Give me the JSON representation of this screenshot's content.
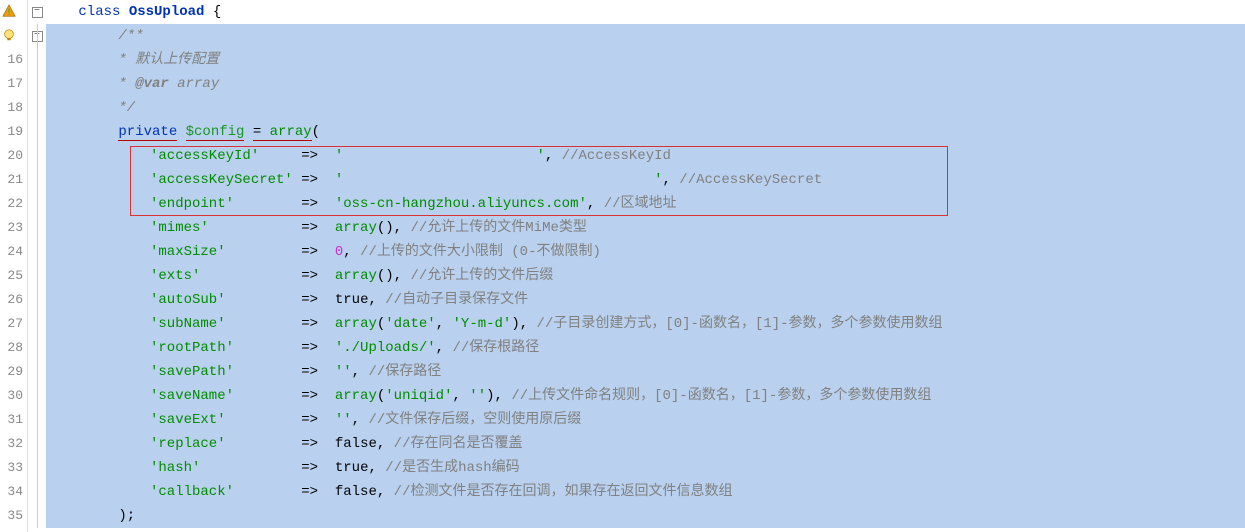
{
  "gutter": {
    "lines": [
      "",
      "",
      "16",
      "17",
      "18",
      "19",
      "20",
      "21",
      "22",
      "23",
      "24",
      "25",
      "26",
      "27",
      "28",
      "29",
      "30",
      "31",
      "32",
      "33",
      "34",
      "35"
    ]
  },
  "code": {
    "kw_class": "class",
    "class_name": "OssUpload",
    "brace_open": "{",
    "doc_open": "/**",
    "doc_l1": " * 默认上传配置",
    "doc_l2_kw": "@var",
    "doc_l2_pre": " * ",
    "doc_l2_type": " array",
    "doc_close": " */",
    "kw_private": "private",
    "var_config": "$config",
    "eq": " = ",
    "kw_array": "array",
    "paren_open": "(",
    "entries": [
      {
        "key": "'accessKeyId'",
        "pad": "    ",
        "arrow": "=>",
        "val": "'                       '",
        "comma": ",",
        "comment": "  //AccessKeyId"
      },
      {
        "key": "'accessKeySecret'",
        "pad": "",
        "arrow": "=>",
        "val": "'                                     '",
        "comma": ",",
        "comment": "  //AccessKeySecret"
      },
      {
        "key": "'endpoint'",
        "pad": "       ",
        "arrow": "=>",
        "val": "'oss-cn-hangzhou.aliyuncs.com'",
        "comma": ",",
        "comment": "  //区域地址"
      },
      {
        "key": "'mimes'",
        "pad": "          ",
        "arrow": "=>",
        "func": "array",
        "args": "()",
        "comma": ",",
        "comment": " //允许上传的文件MiMe类型"
      },
      {
        "key": "'maxSize'",
        "pad": "        ",
        "arrow": "=>",
        "num": "0",
        "comma": ",",
        "comment": " //上传的文件大小限制 (0-不做限制)"
      },
      {
        "key": "'exts'",
        "pad": "           ",
        "arrow": "=>",
        "func": "array",
        "args": "()",
        "comma": ",",
        "comment": " //允许上传的文件后缀"
      },
      {
        "key": "'autoSub'",
        "pad": "        ",
        "arrow": "=>",
        "bool": "true",
        "comma": ",",
        "comment": " //自动子目录保存文件"
      },
      {
        "key": "'subName'",
        "pad": "        ",
        "arrow": "=>",
        "func": "array",
        "args": "('date', 'Y-m-d')",
        "comma": ",",
        "comment": " //子目录创建方式，[0]-函数名，[1]-参数，多个参数使用数组"
      },
      {
        "key": "'rootPath'",
        "pad": "       ",
        "arrow": "=>",
        "val": "'./Uploads/'",
        "comma": ",",
        "comment": " //保存根路径"
      },
      {
        "key": "'savePath'",
        "pad": "       ",
        "arrow": "=>",
        "val": "''",
        "comma": ",",
        "comment": " //保存路径"
      },
      {
        "key": "'saveName'",
        "pad": "       ",
        "arrow": "=>",
        "func": "array",
        "args": "('uniqid', '')",
        "comma": ",",
        "comment": " //上传文件命名规则，[0]-函数名，[1]-参数，多个参数使用数组"
      },
      {
        "key": "'saveExt'",
        "pad": "        ",
        "arrow": "=>",
        "val": "''",
        "comma": ",",
        "comment": " //文件保存后缀，空则使用原后缀"
      },
      {
        "key": "'replace'",
        "pad": "        ",
        "arrow": "=>",
        "bool": "false",
        "comma": ",",
        "comment": " //存在同名是否覆盖"
      },
      {
        "key": "'hash'",
        "pad": "           ",
        "arrow": "=>",
        "bool": "true",
        "comma": ",",
        "comment": " //是否生成hash编码"
      },
      {
        "key": "'callback'",
        "pad": "       ",
        "arrow": "=>",
        "bool": "false",
        "comma": ",",
        "comment": " //检测文件是否存在回调，如果存在返回文件信息数组"
      }
    ],
    "close": ");"
  }
}
